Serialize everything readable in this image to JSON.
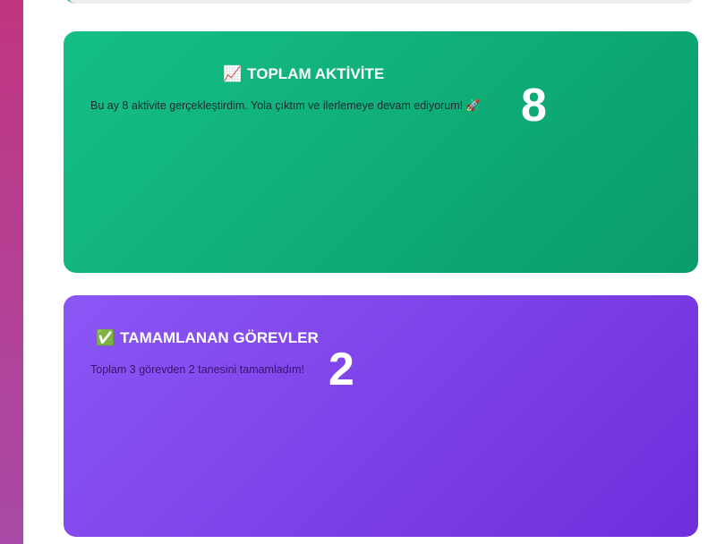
{
  "cards": {
    "activity": {
      "icon": "📈",
      "title": "TOPLAM AKTİVİTE",
      "description": "Bu ay 8 aktivite gerçekleştirdim. Yola çıktım ve ilerlemeye devam ediyorum! 🚀",
      "value": "8",
      "color": "#10b981"
    },
    "tasks": {
      "icon": "✅",
      "title": "TAMAMLANAN GÖREVLER",
      "description": "Toplam 3 görevden 2 tanesini tamamladım!",
      "value": "2",
      "color": "#7c3aed"
    }
  },
  "colors": {
    "sidebar_accent": "#b83d90",
    "green_card": "#10b981",
    "purple_card": "#7c3aed"
  }
}
